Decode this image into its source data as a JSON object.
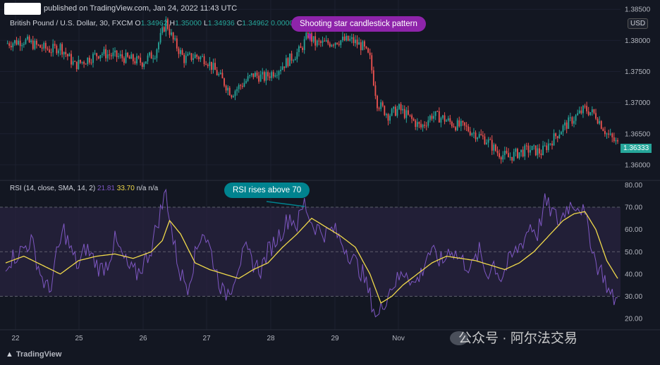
{
  "header": {
    "published": "published on TradingView.com, Jan 24, 2022 11:43 UTC"
  },
  "symbol_bar": {
    "symbol": "British Pound / U.S. Dollar, 30, FXCM",
    "open_label": "O",
    "open": "1.34962",
    "high_label": "H",
    "high": "1.35000",
    "low_label": "L",
    "low": "1.34936",
    "close_label": "C",
    "close": "1.34962",
    "change": "0.00000 (0.00%)"
  },
  "rsi_legend": {
    "name": "RSI (14, close, SMA, 14, 2)",
    "rsi_value": "21.81",
    "sma_value": "33.70",
    "extra": "n/a  n/a"
  },
  "callouts": {
    "shooting_star": "Shooting star candlestick pattern",
    "rsi_rises": "RSI rises above 70"
  },
  "currency_button": "USD",
  "last_price_tag": "1.36333",
  "watermark": "公众号 · 阿尔法交易",
  "brand": "TradingView",
  "colors": {
    "background": "#131722",
    "up_candle": "#26a69a",
    "down_candle": "#ef5350",
    "rsi_line": "#7e57c2",
    "rsi_sma_line": "#f0d94a",
    "rsi_band": "#2a2440",
    "callout_purple": "#8e24aa",
    "callout_teal": "#00838f"
  },
  "chart_data": [
    {
      "type": "candlestick",
      "title": "British Pound / U.S. Dollar, 30, FXCM",
      "ylim": [
        1.3575,
        1.3865
      ],
      "y_ticks": [
        "1.36000",
        "1.36500",
        "1.37000",
        "1.37500",
        "1.38000",
        "1.38500"
      ],
      "x_ticks": [
        "22",
        "25",
        "26",
        "27",
        "28",
        "29",
        "Nov"
      ],
      "approx_close_path": [
        [
          0,
          1.3795
        ],
        [
          10,
          1.38
        ],
        [
          18,
          1.379
        ],
        [
          25,
          1.3785
        ],
        [
          30,
          1.379
        ],
        [
          38,
          1.376
        ],
        [
          45,
          1.377
        ],
        [
          52,
          1.378
        ],
        [
          60,
          1.3775
        ],
        [
          68,
          1.377
        ],
        [
          75,
          1.3765
        ],
        [
          82,
          1.378
        ],
        [
          88,
          1.383
        ],
        [
          92,
          1.38
        ],
        [
          98,
          1.377
        ],
        [
          104,
          1.3775
        ],
        [
          110,
          1.377
        ],
        [
          118,
          1.374
        ],
        [
          124,
          1.3715
        ],
        [
          130,
          1.373
        ],
        [
          136,
          1.3745
        ],
        [
          142,
          1.374
        ],
        [
          150,
          1.3755
        ],
        [
          156,
          1.377
        ],
        [
          162,
          1.3785
        ],
        [
          166,
          1.381
        ],
        [
          170,
          1.3795
        ],
        [
          176,
          1.3795
        ],
        [
          182,
          1.38
        ],
        [
          190,
          1.38
        ],
        [
          196,
          1.379
        ],
        [
          200,
          1.377
        ],
        [
          204,
          1.37
        ],
        [
          210,
          1.368
        ],
        [
          216,
          1.369
        ],
        [
          222,
          1.3675
        ],
        [
          228,
          1.366
        ],
        [
          234,
          1.368
        ],
        [
          240,
          1.3675
        ],
        [
          246,
          1.3665
        ],
        [
          252,
          1.366
        ],
        [
          258,
          1.365
        ],
        [
          264,
          1.364
        ],
        [
          270,
          1.362
        ],
        [
          276,
          1.3612
        ],
        [
          282,
          1.362
        ],
        [
          288,
          1.3625
        ],
        [
          294,
          1.362
        ],
        [
          300,
          1.364
        ],
        [
          306,
          1.366
        ],
        [
          312,
          1.3675
        ],
        [
          318,
          1.369
        ],
        [
          324,
          1.368
        ],
        [
          330,
          1.365
        ],
        [
          336,
          1.3633
        ]
      ],
      "annotations": [
        "Shooting star candlestick pattern"
      ],
      "last_price": "1.36333"
    },
    {
      "type": "line",
      "title": "RSI (14, close, SMA, 14, 2)",
      "ylim": [
        15,
        82
      ],
      "y_ticks": [
        "20.00",
        "30.00",
        "40.00",
        "50.00",
        "60.00",
        "70.00",
        "80.00"
      ],
      "bands": [
        30,
        50,
        70
      ],
      "series": [
        {
          "name": "RSI",
          "values_path": [
            [
              0,
              45
            ],
            [
              8,
              50
            ],
            [
              14,
              55
            ],
            [
              20,
              38
            ],
            [
              24,
              32
            ],
            [
              28,
              48
            ],
            [
              32,
              60
            ],
            [
              36,
              50
            ],
            [
              40,
              43
            ],
            [
              44,
              52
            ],
            [
              48,
              47
            ],
            [
              52,
              42
            ],
            [
              56,
              45
            ],
            [
              60,
              55
            ],
            [
              64,
              48
            ],
            [
              68,
              42
            ],
            [
              72,
              40
            ],
            [
              76,
              45
            ],
            [
              80,
              52
            ],
            [
              84,
              65
            ],
            [
              88,
              77
            ],
            [
              92,
              55
            ],
            [
              96,
              40
            ],
            [
              100,
              35
            ],
            [
              104,
              48
            ],
            [
              108,
              60
            ],
            [
              112,
              52
            ],
            [
              116,
              40
            ],
            [
              120,
              30
            ],
            [
              124,
              35
            ],
            [
              128,
              45
            ],
            [
              132,
              50
            ],
            [
              136,
              45
            ],
            [
              140,
              42
            ],
            [
              144,
              50
            ],
            [
              148,
              55
            ],
            [
              152,
              60
            ],
            [
              156,
              66
            ],
            [
              160,
              62
            ],
            [
              164,
              72
            ],
            [
              168,
              63
            ],
            [
              172,
              60
            ],
            [
              176,
              58
            ],
            [
              180,
              60
            ],
            [
              184,
              55
            ],
            [
              188,
              50
            ],
            [
              192,
              45
            ],
            [
              196,
              40
            ],
            [
              200,
              30
            ],
            [
              204,
              20
            ],
            [
              208,
              28
            ],
            [
              212,
              35
            ],
            [
              216,
              38
            ],
            [
              220,
              42
            ],
            [
              224,
              35
            ],
            [
              228,
              40
            ],
            [
              232,
              50
            ],
            [
              236,
              48
            ],
            [
              240,
              45
            ],
            [
              244,
              52
            ],
            [
              248,
              48
            ],
            [
              252,
              45
            ],
            [
              256,
              43
            ],
            [
              260,
              50
            ],
            [
              264,
              40
            ],
            [
              268,
              45
            ],
            [
              272,
              38
            ],
            [
              276,
              45
            ],
            [
              280,
              50
            ],
            [
              284,
              55
            ],
            [
              288,
              62
            ],
            [
              292,
              58
            ],
            [
              296,
              72
            ],
            [
              300,
              68
            ],
            [
              304,
              63
            ],
            [
              308,
              70
            ],
            [
              312,
              72
            ],
            [
              316,
              70
            ],
            [
              320,
              60
            ],
            [
              324,
              45
            ],
            [
              328,
              40
            ],
            [
              332,
              30
            ],
            [
              336,
              28
            ]
          ]
        },
        {
          "name": "RSI-based MA",
          "values_path": [
            [
              0,
              45
            ],
            [
              10,
              48
            ],
            [
              20,
              44
            ],
            [
              30,
              40
            ],
            [
              40,
              46
            ],
            [
              50,
              48
            ],
            [
              60,
              49
            ],
            [
              70,
              47
            ],
            [
              80,
              50
            ],
            [
              86,
              55
            ],
            [
              90,
              64
            ],
            [
              96,
              58
            ],
            [
              104,
              45
            ],
            [
              112,
              42
            ],
            [
              120,
              40
            ],
            [
              128,
              38
            ],
            [
              136,
              42
            ],
            [
              144,
              45
            ],
            [
              152,
              52
            ],
            [
              160,
              58
            ],
            [
              168,
              65
            ],
            [
              176,
              61
            ],
            [
              184,
              57
            ],
            [
              192,
              52
            ],
            [
              200,
              40
            ],
            [
              206,
              27
            ],
            [
              212,
              30
            ],
            [
              218,
              35
            ],
            [
              226,
              40
            ],
            [
              234,
              45
            ],
            [
              242,
              48
            ],
            [
              250,
              47
            ],
            [
              258,
              46
            ],
            [
              266,
              44
            ],
            [
              274,
              42
            ],
            [
              282,
              45
            ],
            [
              290,
              50
            ],
            [
              298,
              57
            ],
            [
              306,
              64
            ],
            [
              312,
              67
            ],
            [
              318,
              68
            ],
            [
              324,
              60
            ],
            [
              330,
              46
            ],
            [
              336,
              38
            ]
          ]
        }
      ],
      "annotations": [
        "RSI rises above 70"
      ]
    }
  ]
}
